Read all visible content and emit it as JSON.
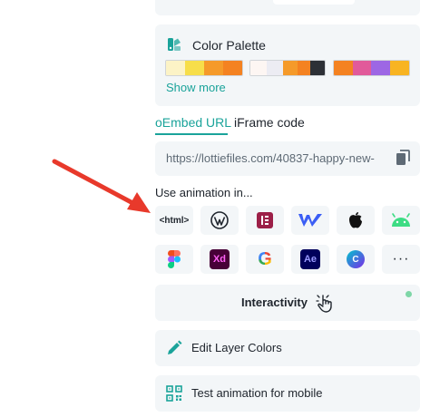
{
  "color_palette": {
    "title": "Color Palette",
    "show_more": "Show more",
    "groups": [
      [
        "#fcf3c6",
        "#f7de4a",
        "#f59a2a",
        "#f48221"
      ],
      [
        "#fdf6f3",
        "#ececf3",
        "#f59a2a",
        "#f48221",
        "#2c3036"
      ],
      [
        "#f48221",
        "#e15a9a",
        "#9d67e4",
        "#f8b422"
      ]
    ]
  },
  "embed_tabs": {
    "oembed": "oEmbed URL",
    "iframe": "iFrame code"
  },
  "embed_url": {
    "value": "https://lottiefiles.com/40837-happy-new-"
  },
  "use_animation": {
    "title": "Use animation in...",
    "html_label": "<html>",
    "xd_label": "Xd",
    "ae_label": "Ae",
    "g_label": "G",
    "c_label": "C",
    "more_label": "···"
  },
  "interactivity": {
    "label": "Interactivity"
  },
  "edit_layer_colors": {
    "label": "Edit Layer Colors"
  },
  "test_mobile": {
    "label": "Test animation for mobile"
  }
}
